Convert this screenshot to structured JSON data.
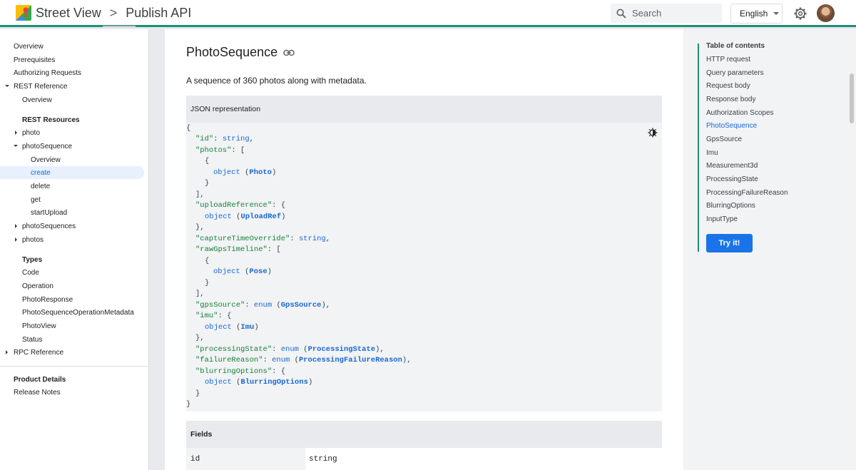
{
  "header": {
    "product": "Street View",
    "separator": ">",
    "page": "Publish API",
    "search_placeholder": "Search",
    "language": "English"
  },
  "sidebar": {
    "items": [
      {
        "label": "Overview"
      },
      {
        "label": "Prerequisites"
      },
      {
        "label": "Authorizing Requests"
      },
      {
        "label": "REST Reference"
      },
      {
        "label": "Overview"
      },
      {
        "label": "REST Resources"
      },
      {
        "label": "photo"
      },
      {
        "label": "photoSequence"
      },
      {
        "label": "Overview"
      },
      {
        "label": "create"
      },
      {
        "label": "delete"
      },
      {
        "label": "get"
      },
      {
        "label": "startUpload"
      },
      {
        "label": "photoSequences"
      },
      {
        "label": "photos"
      },
      {
        "label": "Types"
      },
      {
        "label": "Code"
      },
      {
        "label": "Operation"
      },
      {
        "label": "PhotoResponse"
      },
      {
        "label": "PhotoSequenceOperationMetadata"
      },
      {
        "label": "PhotoView"
      },
      {
        "label": "Status"
      },
      {
        "label": "RPC Reference"
      },
      {
        "label": "Product Details"
      },
      {
        "label": "Release Notes"
      }
    ]
  },
  "main": {
    "title": "PhotoSequence",
    "description": "A sequence of 360 photos along with metadata.",
    "json_header": "JSON representation",
    "code": {
      "l0": "{",
      "id_key": "\"id\"",
      "string": "string",
      "photos_key": "\"photos\"",
      "uploadReference_key": "\"uploadReference\"",
      "captureTimeOverride_key": "\"captureTimeOverride\"",
      "rawGpsTimeline_key": "\"rawGpsTimeline\"",
      "gpsSource_key": "\"gpsSource\"",
      "imu_key": "\"imu\"",
      "processingState_key": "\"processingState\"",
      "failureReason_key": "\"failureReason\"",
      "blurringOptions_key": "\"blurringOptions\"",
      "object": "object",
      "enum": "enum",
      "link_photo": "Photo",
      "link_uploadref": "UploadRef",
      "link_pose": "Pose",
      "link_gpssource": "GpsSource",
      "link_imu": "Imu",
      "link_processingstate": "ProcessingState",
      "link_processingfailurereason": "ProcessingFailureReason",
      "link_blurringoptions": "BlurringOptions"
    },
    "fields_header": "Fields",
    "fields": [
      {
        "name": "id",
        "type": "string"
      }
    ]
  },
  "toc": {
    "title": "Table of contents",
    "items": [
      {
        "label": "HTTP request"
      },
      {
        "label": "Query parameters"
      },
      {
        "label": "Request body"
      },
      {
        "label": "Response body"
      },
      {
        "label": "Authorization Scopes"
      },
      {
        "label": "PhotoSequence"
      },
      {
        "label": "GpsSource"
      },
      {
        "label": "Imu"
      },
      {
        "label": "Measurement3d"
      },
      {
        "label": "ProcessingState"
      },
      {
        "label": "ProcessingFailureReason"
      },
      {
        "label": "BlurringOptions"
      },
      {
        "label": "InputType"
      }
    ],
    "try_button": "Try it!"
  },
  "colors": {
    "accent": "#1e8e76",
    "link": "#1967d2",
    "button": "#1a73e8"
  },
  "icons": [
    "street-view-logo",
    "search-icon",
    "chevron-down-icon",
    "gear-icon",
    "avatar",
    "link-icon",
    "theme-toggle-icon"
  ]
}
